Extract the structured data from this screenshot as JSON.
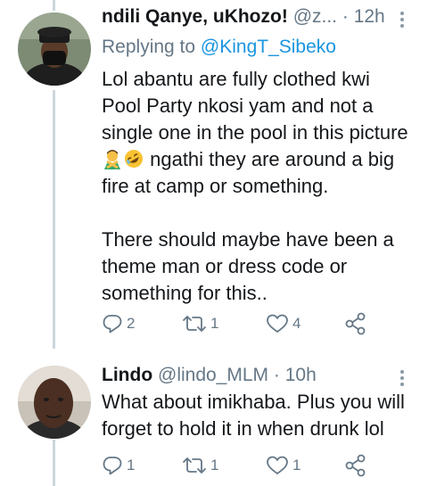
{
  "tweets": [
    {
      "name": "ndili Qanye, uKhozo!",
      "handle": "@z...",
      "separator": "·",
      "time": "12h",
      "replying_label": "Replying to",
      "replying_handle": "@KingT_Sibeko",
      "text_line1": "Lol abantu are fully clothed kwi Pool Party nkosi yam and not a single one in the pool in this picture",
      "text_line2": " ngathi they are around a big fire at camp or something.",
      "text_para2": "There should maybe have been a theme man or dress code or something for this..",
      "emojis": [
        "man-gesturing-no-emoji",
        "rolling-on-floor-laughing-emoji"
      ],
      "reply_count": "2",
      "retweet_count": "1",
      "like_count": "4"
    },
    {
      "name": "Lindo",
      "handle": "@lindo_MLM",
      "separator": "·",
      "time": "10h",
      "text": "What about imikhaba. Plus you will forget to hold it in when drunk lol",
      "reply_count": "1",
      "retweet_count": "1",
      "like_count": "1"
    }
  ],
  "colors": {
    "text": "#14171a",
    "muted": "#657786",
    "link": "#1b95e0",
    "thread_line": "#ccd6dd"
  },
  "icons": [
    "reply-icon",
    "retweet-icon",
    "like-icon",
    "share-icon",
    "more-icon"
  ]
}
